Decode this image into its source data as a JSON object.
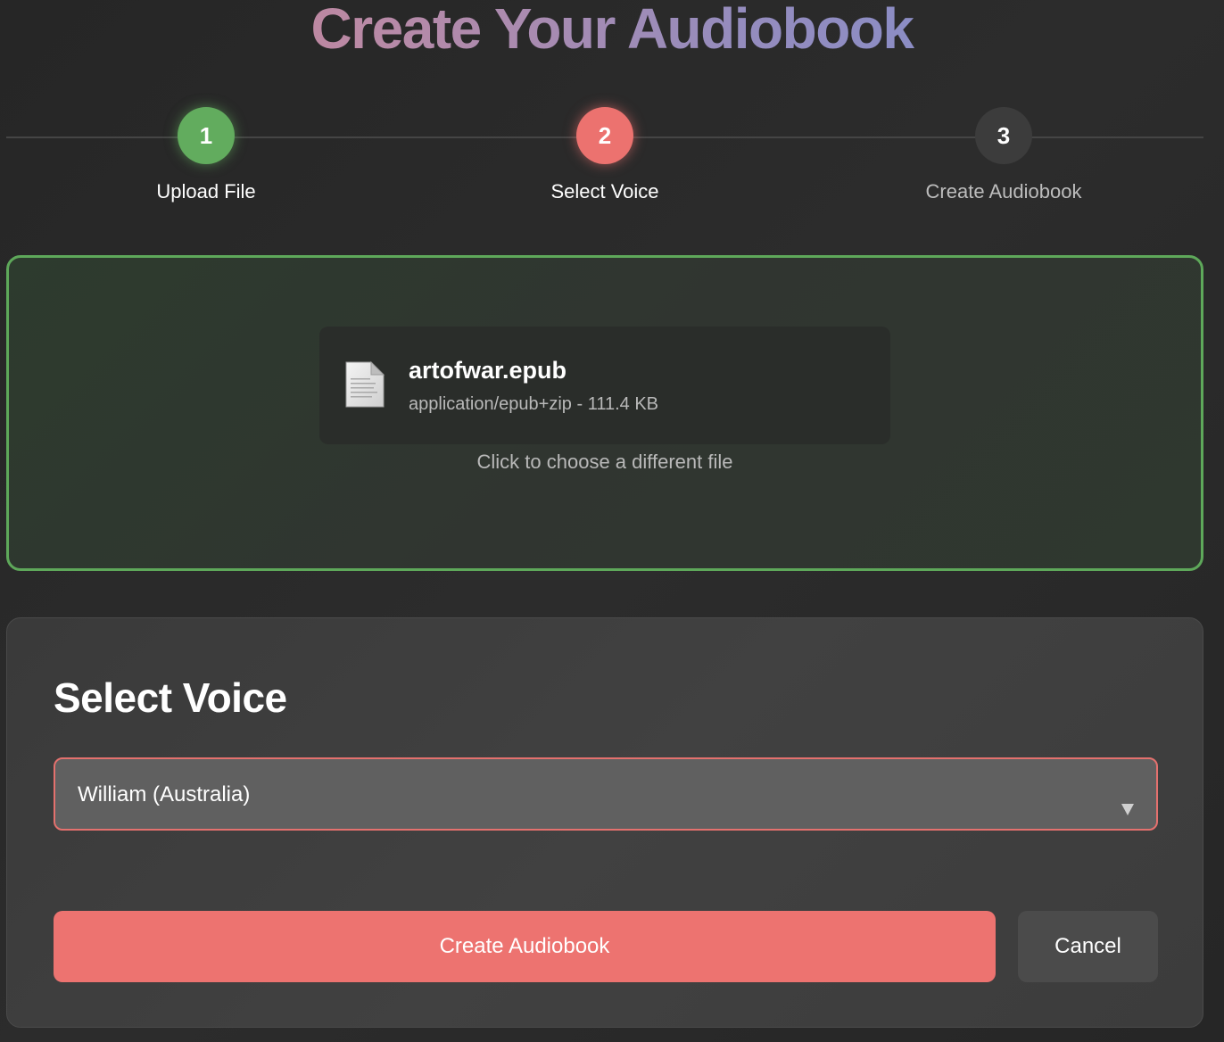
{
  "header": {
    "title": "Create Your Audiobook"
  },
  "stepper": {
    "steps": [
      {
        "number": "1",
        "label": "Upload File",
        "state": "done"
      },
      {
        "number": "2",
        "label": "Select Voice",
        "state": "active"
      },
      {
        "number": "3",
        "label": "Create Audiobook",
        "state": "todo"
      }
    ]
  },
  "upload": {
    "file_name": "artofwar.epub",
    "file_meta": "application/epub+zip - 111.4 KB",
    "hint": "Click to choose a different file",
    "file_icon": "document-icon"
  },
  "voice": {
    "title": "Select Voice",
    "selected": "William (Australia)"
  },
  "actions": {
    "create_label": "Create Audiobook",
    "cancel_label": "Cancel"
  },
  "colors": {
    "accent": "#ed7370",
    "success": "#62ac5e",
    "background": "#2a2a2a"
  }
}
